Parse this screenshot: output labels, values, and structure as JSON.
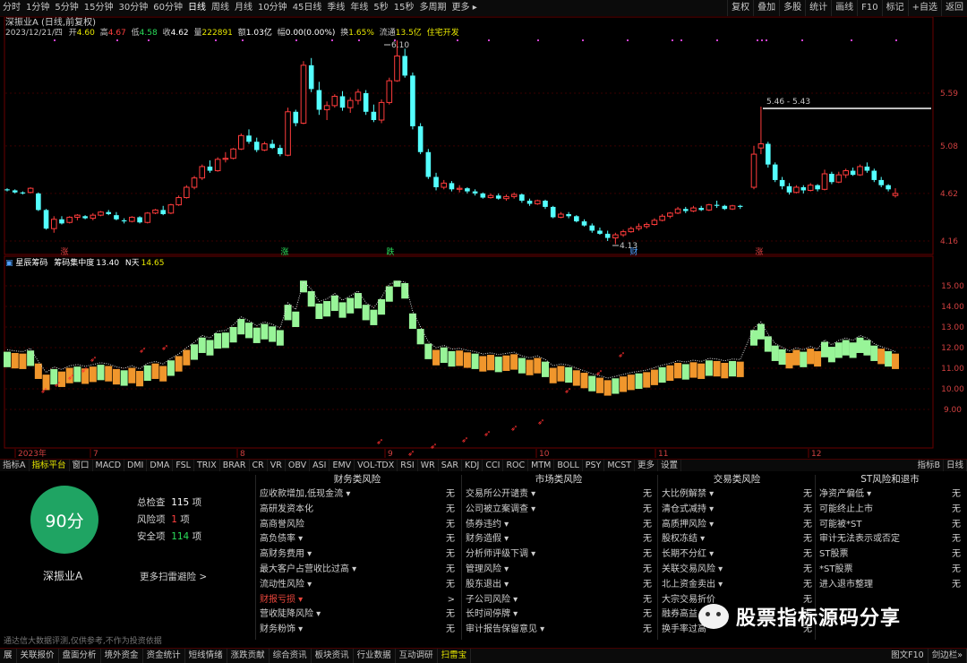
{
  "toolbar": {
    "periods": [
      "分时",
      "1分钟",
      "5分钟",
      "15分钟",
      "30分钟",
      "60分钟",
      "日线",
      "周线",
      "月线",
      "10分钟",
      "45日线",
      "季线",
      "年线",
      "5秒",
      "15秒",
      "多周期",
      "更多 ▸"
    ],
    "active_period": "日线",
    "right": [
      "复权",
      "叠加",
      "多股",
      "统计",
      "画线",
      "F10",
      "标记",
      "+自选",
      "返回"
    ]
  },
  "main_chart": {
    "stock_title": "深振业A (日线,前复权)",
    "quote_line": {
      "date": "2023/12/21/四",
      "open_label": "开",
      "open": "4.60",
      "high_label": "高",
      "high": "4.67",
      "low_label": "低",
      "low": "4.58",
      "close_label": "收",
      "close": "4.62",
      "volume_label": "量",
      "volume": "222891",
      "amount_label": "额",
      "amount": "1.03亿",
      "change_label": "幅",
      "change": "0.00(0.00%)",
      "turnover_label": "换",
      "turnover": "1.65%",
      "float_label": "流通",
      "float": "13.5亿",
      "sector": "住宅开发"
    },
    "y_ticks": [
      "5.59",
      "5.08",
      "4.62",
      "4.16"
    ],
    "annotations": {
      "high": "6.10",
      "low": "4.13",
      "range": "5.46 - 5.43"
    },
    "event_markers": [
      "涨",
      "涨",
      "跌",
      "财",
      "涨"
    ]
  },
  "indicator": {
    "title": "星辰筹码",
    "metric_label": "筹码集中度",
    "metric_value": "13.40",
    "n_label": "N天",
    "n_value": "14.65",
    "y_ticks": [
      "15.00",
      "14.00",
      "13.00",
      "12.00",
      "11.00",
      "10.00",
      "9.00"
    ]
  },
  "x_axis": {
    "labels": [
      "2023年",
      "7",
      "8",
      "9",
      "10",
      "11",
      "12"
    ]
  },
  "indicator_tabs": {
    "items": [
      "指标A",
      "指标平台",
      "窗口",
      "MACD",
      "DMI",
      "DMA",
      "FSL",
      "TRIX",
      "BRAR",
      "CR",
      "VR",
      "OBV",
      "ASI",
      "EMV",
      "VOL-TDX",
      "RSI",
      "WR",
      "SAR",
      "KDJ",
      "CCI",
      "ROC",
      "MTM",
      "BOLL",
      "PSY",
      "MCST",
      "更多",
      "设置"
    ],
    "active": "指标平台",
    "right": [
      "指标B",
      "日线"
    ]
  },
  "risk": {
    "score": "90分",
    "stock_name": "深振业A",
    "total_label": "总检查",
    "total_value": "115",
    "total_unit": "项",
    "risk_label": "风险项",
    "risk_value": "1",
    "risk_unit": "项",
    "safe_label": "安全项",
    "safe_value": "114",
    "safe_unit": "项",
    "more_link": "更多扫雷避险 >",
    "columns": [
      {
        "title": "财务类风险",
        "items": [
          {
            "label": "应收款增加,低现金流 ▾",
            "status": "无"
          },
          {
            "label": "高研发资本化",
            "status": "无"
          },
          {
            "label": "高商誉风险",
            "status": "无"
          },
          {
            "label": "高负债率 ▾",
            "status": "无"
          },
          {
            "label": "高财务费用 ▾",
            "status": "无"
          },
          {
            "label": "最大客户占营收比过高 ▾",
            "status": "无"
          },
          {
            "label": "流动性风险 ▾",
            "status": "无"
          },
          {
            "label": "财报亏损 ▾",
            "status": ">"
          },
          {
            "label": "营收陡降风险 ▾",
            "status": "无"
          },
          {
            "label": "财务粉饰 ▾",
            "status": "无"
          }
        ]
      },
      {
        "title": "市场类风险",
        "items": [
          {
            "label": "交易所公开谴责 ▾",
            "status": "无"
          },
          {
            "label": "公司被立案调查 ▾",
            "status": "无"
          },
          {
            "label": "债券违约 ▾",
            "status": "无"
          },
          {
            "label": "财务造假 ▾",
            "status": "无"
          },
          {
            "label": "分析师评级下调 ▾",
            "status": "无"
          },
          {
            "label": "管理风险 ▾",
            "status": "无"
          },
          {
            "label": "股东退出 ▾",
            "status": "无"
          },
          {
            "label": "子公司风险 ▾",
            "status": "无"
          },
          {
            "label": "长时间停牌 ▾",
            "status": "无"
          },
          {
            "label": "审计报告保留意见 ▾",
            "status": "无"
          }
        ]
      },
      {
        "title": "交易类风险",
        "items": [
          {
            "label": "大比例解禁 ▾",
            "status": "无"
          },
          {
            "label": "清仓式减持 ▾",
            "status": "无"
          },
          {
            "label": "高质押风险 ▾",
            "status": "无"
          },
          {
            "label": "股权冻结 ▾",
            "status": "无"
          },
          {
            "label": "长期不分红 ▾",
            "status": "无"
          },
          {
            "label": "关联交易风险 ▾",
            "status": "无"
          },
          {
            "label": "北上资金卖出 ▾",
            "status": "无"
          },
          {
            "label": "大宗交易折价",
            "status": "无"
          },
          {
            "label": "融券高益",
            "status": "无"
          },
          {
            "label": "换手率过高",
            "status": "无"
          }
        ]
      },
      {
        "title": "ST风险和退市",
        "items": [
          {
            "label": "净资产偏低 ▾",
            "status": "无"
          },
          {
            "label": "可能终止上市",
            "status": "无"
          },
          {
            "label": "可能被*ST",
            "status": "无"
          },
          {
            "label": "审计无法表示或否定",
            "status": "无"
          },
          {
            "label": "ST股票",
            "status": "无"
          },
          {
            "label": "*ST股票",
            "status": "无"
          },
          {
            "label": "进入退市整理",
            "status": "无"
          }
        ]
      }
    ],
    "disclaimer": "通达信大数据评测,仅供参考,不作为投资依据"
  },
  "watermark": "股票指标源码分享",
  "bottom_tabs": {
    "items": [
      "展",
      "关联报价",
      "盘面分析",
      "境外资金",
      "资金统计",
      "短线情绪",
      "涨跌贡献",
      "综合资讯",
      "板块资讯",
      "行业数据",
      "互动调研",
      "扫雷宝"
    ],
    "active": "扫雷宝",
    "right": [
      "图文F10",
      "剑边栏»"
    ]
  },
  "chart_data": {
    "type": "candlestick",
    "period": "日线",
    "x_labels": [
      "2023年",
      "7",
      "8",
      "9",
      "10",
      "11",
      "12"
    ],
    "price_axis": [
      4.16,
      4.62,
      5.08,
      5.59
    ],
    "ohlc": [
      [
        4.66,
        4.67,
        4.64,
        4.65
      ],
      [
        4.65,
        4.66,
        4.62,
        4.63
      ],
      [
        4.63,
        4.64,
        4.61,
        4.62
      ],
      [
        4.63,
        4.68,
        4.62,
        4.67
      ],
      [
        4.62,
        4.63,
        4.45,
        4.46
      ],
      [
        4.46,
        4.47,
        4.27,
        4.28
      ],
      [
        4.28,
        4.4,
        4.24,
        4.37
      ],
      [
        4.37,
        4.4,
        4.32,
        4.33
      ],
      [
        4.34,
        4.4,
        4.33,
        4.39
      ],
      [
        4.39,
        4.42,
        4.36,
        4.41
      ],
      [
        4.4,
        4.41,
        4.37,
        4.38
      ],
      [
        4.38,
        4.43,
        4.36,
        4.41
      ],
      [
        4.41,
        4.45,
        4.4,
        4.44
      ],
      [
        4.44,
        4.46,
        4.41,
        4.42
      ],
      [
        4.41,
        4.44,
        4.36,
        4.37
      ],
      [
        4.36,
        4.38,
        4.33,
        4.35
      ],
      [
        4.35,
        4.4,
        4.34,
        4.39
      ],
      [
        4.39,
        4.4,
        4.33,
        4.34
      ],
      [
        4.34,
        4.44,
        4.33,
        4.43
      ],
      [
        4.43,
        4.47,
        4.42,
        4.46
      ],
      [
        4.46,
        4.5,
        4.41,
        4.42
      ],
      [
        4.43,
        4.52,
        4.42,
        4.51
      ],
      [
        4.51,
        4.6,
        4.5,
        4.58
      ],
      [
        4.58,
        4.7,
        4.57,
        4.68
      ],
      [
        4.68,
        4.79,
        4.66,
        4.77
      ],
      [
        4.77,
        4.9,
        4.75,
        4.88
      ],
      [
        4.88,
        4.94,
        4.82,
        4.84
      ],
      [
        4.84,
        4.97,
        4.83,
        4.95
      ],
      [
        4.95,
        5.02,
        4.92,
        4.96
      ],
      [
        4.96,
        5.06,
        4.95,
        5.05
      ],
      [
        5.05,
        5.2,
        5.04,
        5.18
      ],
      [
        5.18,
        5.24,
        5.1,
        5.12
      ],
      [
        5.12,
        5.16,
        5.02,
        5.04
      ],
      [
        5.04,
        5.12,
        5.03,
        5.1
      ],
      [
        5.1,
        5.14,
        5.05,
        5.06
      ],
      [
        5.06,
        5.09,
        4.98,
        5.0
      ],
      [
        4.99,
        5.45,
        4.98,
        5.41
      ],
      [
        5.41,
        5.43,
        5.27,
        5.3
      ],
      [
        5.3,
        5.9,
        5.29,
        5.86
      ],
      [
        5.86,
        5.93,
        5.6,
        5.63
      ],
      [
        5.62,
        5.7,
        5.38,
        5.43
      ],
      [
        5.43,
        5.51,
        5.33,
        5.47
      ],
      [
        5.47,
        5.58,
        5.45,
        5.56
      ],
      [
        5.56,
        5.61,
        5.42,
        5.45
      ],
      [
        5.45,
        5.55,
        5.4,
        5.52
      ],
      [
        5.52,
        5.63,
        5.48,
        5.6
      ],
      [
        5.59,
        5.62,
        5.38,
        5.41
      ],
      [
        5.41,
        5.48,
        5.31,
        5.33
      ],
      [
        5.33,
        5.53,
        5.3,
        5.5
      ],
      [
        5.5,
        5.74,
        5.48,
        5.71
      ],
      [
        5.71,
        6.1,
        5.7,
        5.95
      ],
      [
        5.95,
        6.02,
        5.74,
        5.76
      ],
      [
        5.76,
        5.79,
        5.24,
        5.27
      ],
      [
        5.27,
        5.3,
        5.0,
        5.02
      ],
      [
        5.02,
        5.05,
        4.76,
        4.78
      ],
      [
        4.78,
        4.82,
        4.65,
        4.68
      ],
      [
        4.68,
        4.75,
        4.66,
        4.72
      ],
      [
        4.72,
        4.74,
        4.64,
        4.66
      ],
      [
        4.66,
        4.7,
        4.63,
        4.67
      ],
      [
        4.67,
        4.68,
        4.62,
        4.64
      ],
      [
        4.64,
        4.66,
        4.6,
        4.62
      ],
      [
        4.62,
        4.63,
        4.57,
        4.58
      ],
      [
        4.58,
        4.62,
        4.57,
        4.6
      ],
      [
        4.6,
        4.62,
        4.56,
        4.57
      ],
      [
        4.57,
        4.61,
        4.55,
        4.59
      ],
      [
        4.59,
        4.63,
        4.57,
        4.61
      ],
      [
        4.61,
        4.62,
        4.53,
        4.55
      ],
      [
        4.55,
        4.57,
        4.5,
        4.52
      ],
      [
        4.52,
        4.56,
        4.51,
        4.55
      ],
      [
        4.55,
        4.56,
        4.47,
        4.49
      ],
      [
        4.49,
        4.5,
        4.38,
        4.39
      ],
      [
        4.39,
        4.44,
        4.38,
        4.42
      ],
      [
        4.42,
        4.44,
        4.38,
        4.4
      ],
      [
        4.4,
        4.41,
        4.34,
        4.35
      ],
      [
        4.35,
        4.37,
        4.3,
        4.31
      ],
      [
        4.31,
        4.33,
        4.24,
        4.26
      ],
      [
        4.26,
        4.29,
        4.22,
        4.23
      ],
      [
        4.23,
        4.26,
        4.16,
        4.19
      ],
      [
        4.19,
        4.24,
        4.13,
        4.22
      ],
      [
        4.22,
        4.27,
        4.2,
        4.25
      ],
      [
        4.25,
        4.3,
        4.24,
        4.28
      ],
      [
        4.28,
        4.33,
        4.26,
        4.3
      ],
      [
        4.3,
        4.34,
        4.28,
        4.32
      ],
      [
        4.32,
        4.38,
        4.31,
        4.36
      ],
      [
        4.36,
        4.42,
        4.35,
        4.4
      ],
      [
        4.4,
        4.44,
        4.38,
        4.43
      ],
      [
        4.43,
        4.49,
        4.42,
        4.47
      ],
      [
        4.47,
        4.49,
        4.43,
        4.45
      ],
      [
        4.45,
        4.5,
        4.44,
        4.48
      ],
      [
        4.48,
        4.5,
        4.45,
        4.46
      ],
      [
        4.46,
        4.52,
        4.45,
        4.51
      ],
      [
        4.51,
        4.55,
        4.48,
        4.5
      ],
      [
        4.5,
        4.51,
        4.46,
        4.47
      ],
      [
        4.47,
        4.51,
        4.46,
        4.5
      ],
      [
        4.5,
        4.51,
        4.47,
        4.49
      ],
      [
        4.68,
        5.08,
        4.66,
        5.0
      ],
      [
        5.06,
        5.46,
        5.0,
        5.1
      ],
      [
        5.1,
        5.12,
        4.87,
        4.9
      ],
      [
        4.9,
        4.92,
        4.73,
        4.75
      ],
      [
        4.75,
        4.78,
        4.66,
        4.69
      ],
      [
        4.69,
        4.72,
        4.61,
        4.63
      ],
      [
        4.63,
        4.7,
        4.62,
        4.68
      ],
      [
        4.68,
        4.7,
        4.62,
        4.65
      ],
      [
        4.65,
        4.72,
        4.64,
        4.7
      ],
      [
        4.7,
        4.71,
        4.64,
        4.66
      ],
      [
        4.66,
        4.85,
        4.65,
        4.81
      ],
      [
        4.81,
        4.83,
        4.71,
        4.73
      ],
      [
        4.73,
        4.83,
        4.72,
        4.8
      ],
      [
        4.8,
        4.86,
        4.77,
        4.84
      ],
      [
        4.84,
        4.87,
        4.79,
        4.8
      ],
      [
        4.8,
        4.9,
        4.79,
        4.88
      ],
      [
        4.88,
        4.92,
        4.82,
        4.84
      ],
      [
        4.84,
        4.86,
        4.73,
        4.75
      ],
      [
        4.75,
        4.78,
        4.68,
        4.7
      ],
      [
        4.7,
        4.71,
        4.64,
        4.66
      ],
      [
        4.6,
        4.67,
        4.58,
        4.62
      ]
    ],
    "indicator": {
      "name": "星辰筹码",
      "y_ticks": [
        15,
        14,
        13,
        12,
        11,
        10,
        9
      ],
      "values": [
        13.4,
        14.65
      ]
    }
  }
}
